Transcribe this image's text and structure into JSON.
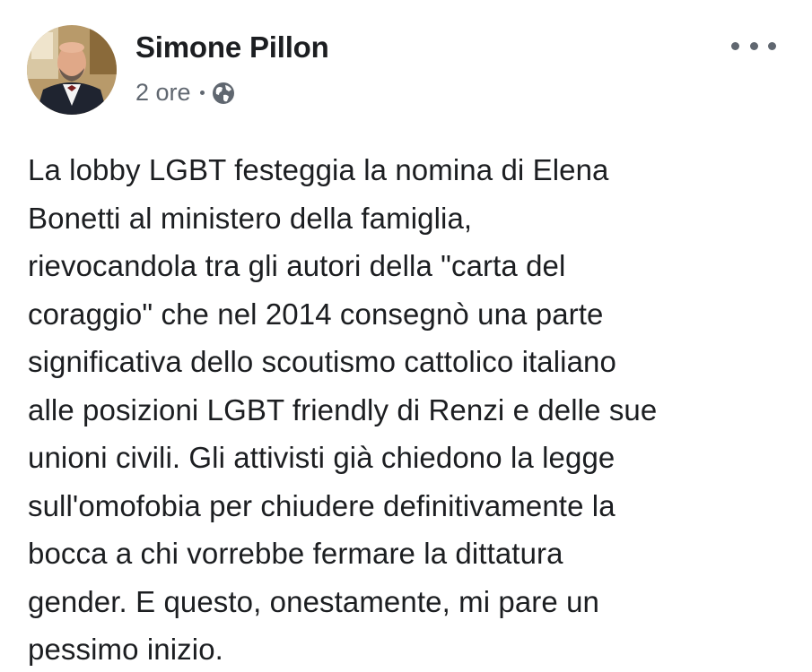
{
  "post": {
    "author": {
      "name": "Simone Pillon",
      "avatar_icon": "profile-photo"
    },
    "timestamp": "2 ore",
    "audience_icon": "globe-icon",
    "more_icon": "more-options-icon",
    "text_lines": [
      "La lobby LGBT festeggia la nomina di Elena",
      "Bonetti al ministero della famiglia,",
      "rievocandola tra gli autori della \"carta del",
      "coraggio\" che nel 2014 consegnò una parte",
      "significativa dello scoutismo cattolico italiano",
      "alle posizioni LGBT friendly di Renzi e delle sue",
      "unioni civili. Gli attivisti già chiedono la legge",
      "sull'omofobia per chiudere definitivamente la",
      "bocca a chi vorrebbe fermare la dittatura",
      "gender. E questo, onestamente, mi pare un",
      "pessimo inizio."
    ],
    "colors": {
      "name": "#1c1e21",
      "meta": "#606770",
      "text": "#1c1e21"
    }
  }
}
